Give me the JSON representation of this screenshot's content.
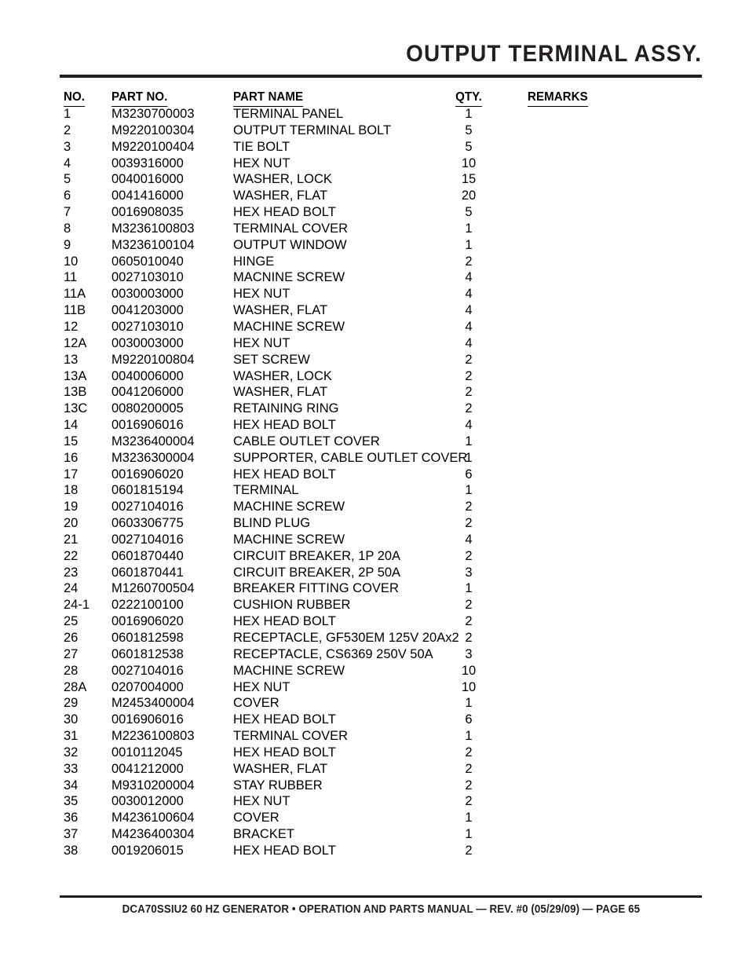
{
  "document": {
    "title": "OUTPUT TERMINAL ASSY.",
    "footer": "DCA70SSIU2 60 HZ GENERATOR • OPERATION AND PARTS MANUAL — REV. #0 (05/29/09) — PAGE 65",
    "page_number": "65"
  },
  "table": {
    "headers": {
      "no": "NO.",
      "part_no": "PART NO.",
      "part_name": "PART NAME",
      "qty": "QTY.",
      "remarks": "REMARKS"
    },
    "rows": [
      {
        "no": "1",
        "part_no": "M3230700003",
        "part_name": "TERMINAL PANEL",
        "qty": "1",
        "remarks": ""
      },
      {
        "no": "2",
        "part_no": "M9220100304",
        "part_name": "OUTPUT TERMINAL  BOLT",
        "qty": "5",
        "remarks": ""
      },
      {
        "no": "3",
        "part_no": "M9220100404",
        "part_name": "TIE BOLT",
        "qty": "5",
        "remarks": ""
      },
      {
        "no": "4",
        "part_no": "0039316000",
        "part_name": "HEX NUT",
        "qty": "10",
        "remarks": ""
      },
      {
        "no": "5",
        "part_no": "0040016000",
        "part_name": "WASHER, LOCK",
        "qty": "15",
        "remarks": ""
      },
      {
        "no": "6",
        "part_no": "0041416000",
        "part_name": "WASHER, FLAT",
        "qty": "20",
        "remarks": ""
      },
      {
        "no": "7",
        "part_no": "0016908035",
        "part_name": "HEX HEAD BOLT",
        "qty": "5",
        "remarks": ""
      },
      {
        "no": "8",
        "part_no": "M3236100803",
        "part_name": "TERMINAL COVER",
        "qty": "1",
        "remarks": ""
      },
      {
        "no": "9",
        "part_no": "M3236100104",
        "part_name": "OUTPUT WINDOW",
        "qty": "1",
        "remarks": ""
      },
      {
        "no": "10",
        "part_no": "0605010040",
        "part_name": "HINGE",
        "qty": "2",
        "remarks": ""
      },
      {
        "no": "11",
        "part_no": "0027103010",
        "part_name": "MACNINE SCREW",
        "qty": "4",
        "remarks": ""
      },
      {
        "no": "11A",
        "part_no": "0030003000",
        "part_name": "HEX NUT",
        "qty": "4",
        "remarks": ""
      },
      {
        "no": "11B",
        "part_no": "0041203000",
        "part_name": "WASHER, FLAT",
        "qty": "4",
        "remarks": ""
      },
      {
        "no": "12",
        "part_no": "0027103010",
        "part_name": "MACHINE SCREW",
        "qty": "4",
        "remarks": ""
      },
      {
        "no": "12A",
        "part_no": "0030003000",
        "part_name": "HEX NUT",
        "qty": "4",
        "remarks": ""
      },
      {
        "no": "13",
        "part_no": "M9220100804",
        "part_name": "SET SCREW",
        "qty": "2",
        "remarks": ""
      },
      {
        "no": "13A",
        "part_no": "0040006000",
        "part_name": "WASHER, LOCK",
        "qty": "2",
        "remarks": ""
      },
      {
        "no": "13B",
        "part_no": "0041206000",
        "part_name": "WASHER, FLAT",
        "qty": "2",
        "remarks": ""
      },
      {
        "no": "13C",
        "part_no": "0080200005",
        "part_name": "RETAINING RING",
        "qty": "2",
        "remarks": ""
      },
      {
        "no": "14",
        "part_no": "0016906016",
        "part_name": "HEX HEAD BOLT",
        "qty": "4",
        "remarks": ""
      },
      {
        "no": "15",
        "part_no": "M3236400004",
        "part_name": "CABLE OUTLET COVER",
        "qty": "1",
        "remarks": ""
      },
      {
        "no": "16",
        "part_no": "M3236300004",
        "part_name": "SUPPORTER, CABLE OUTLET COVER",
        "qty": "1",
        "remarks": ""
      },
      {
        "no": "17",
        "part_no": "0016906020",
        "part_name": "HEX HEAD BOLT",
        "qty": "6",
        "remarks": ""
      },
      {
        "no": "18",
        "part_no": "0601815194",
        "part_name": "TERMINAL",
        "qty": "1",
        "remarks": ""
      },
      {
        "no": "19",
        "part_no": "0027104016",
        "part_name": "MACHINE SCREW",
        "qty": "2",
        "remarks": ""
      },
      {
        "no": "20",
        "part_no": "0603306775",
        "part_name": "BLIND PLUG",
        "qty": "2",
        "remarks": ""
      },
      {
        "no": "21",
        "part_no": "0027104016",
        "part_name": "MACHINE SCREW",
        "qty": "4",
        "remarks": ""
      },
      {
        "no": "22",
        "part_no": "0601870440",
        "part_name": "CIRCUIT BREAKER, 1P 20A",
        "qty": "2",
        "remarks": ""
      },
      {
        "no": "23",
        "part_no": "0601870441",
        "part_name": "CIRCUIT BREAKER, 2P 50A",
        "qty": "3",
        "remarks": ""
      },
      {
        "no": "24",
        "part_no": "M1260700504",
        "part_name": "BREAKER FITTING COVER",
        "qty": "1",
        "remarks": ""
      },
      {
        "no": "24-1",
        "part_no": "0222100100",
        "part_name": "CUSHION RUBBER",
        "qty": "2",
        "remarks": ""
      },
      {
        "no": "25",
        "part_no": "0016906020",
        "part_name": "HEX HEAD BOLT",
        "qty": "2",
        "remarks": ""
      },
      {
        "no": "26",
        "part_no": "0601812598",
        "part_name": "RECEPTACLE, GF530EM 125V 20Ax2",
        "qty": "2",
        "remarks": ""
      },
      {
        "no": "27",
        "part_no": "0601812538",
        "part_name": "RECEPTACLE, CS6369 250V 50A",
        "qty": "3",
        "remarks": ""
      },
      {
        "no": "28",
        "part_no": "0027104016",
        "part_name": "MACHINE SCREW",
        "qty": "10",
        "remarks": ""
      },
      {
        "no": "28A",
        "part_no": "0207004000",
        "part_name": "HEX NUT",
        "qty": "10",
        "remarks": ""
      },
      {
        "no": "29",
        "part_no": "M2453400004",
        "part_name": "COVER",
        "qty": "1",
        "remarks": ""
      },
      {
        "no": "30",
        "part_no": "0016906016",
        "part_name": "HEX HEAD BOLT",
        "qty": "6",
        "remarks": ""
      },
      {
        "no": "31",
        "part_no": "M2236100803",
        "part_name": "TERMINAL COVER",
        "qty": "1",
        "remarks": ""
      },
      {
        "no": "32",
        "part_no": "0010112045",
        "part_name": "HEX HEAD BOLT",
        "qty": "2",
        "remarks": ""
      },
      {
        "no": "33",
        "part_no": "0041212000",
        "part_name": "WASHER, FLAT",
        "qty": "2",
        "remarks": ""
      },
      {
        "no": "34",
        "part_no": "M9310200004",
        "part_name": "STAY RUBBER",
        "qty": "2",
        "remarks": ""
      },
      {
        "no": "35",
        "part_no": "0030012000",
        "part_name": "HEX NUT",
        "qty": "2",
        "remarks": ""
      },
      {
        "no": "36",
        "part_no": "M4236100604",
        "part_name": "COVER",
        "qty": "1",
        "remarks": ""
      },
      {
        "no": "37",
        "part_no": "M4236400304",
        "part_name": "BRACKET",
        "qty": "1",
        "remarks": ""
      },
      {
        "no": "38",
        "part_no": "0019206015",
        "part_name": "HEX HEAD BOLT",
        "qty": "2",
        "remarks": ""
      }
    ]
  }
}
